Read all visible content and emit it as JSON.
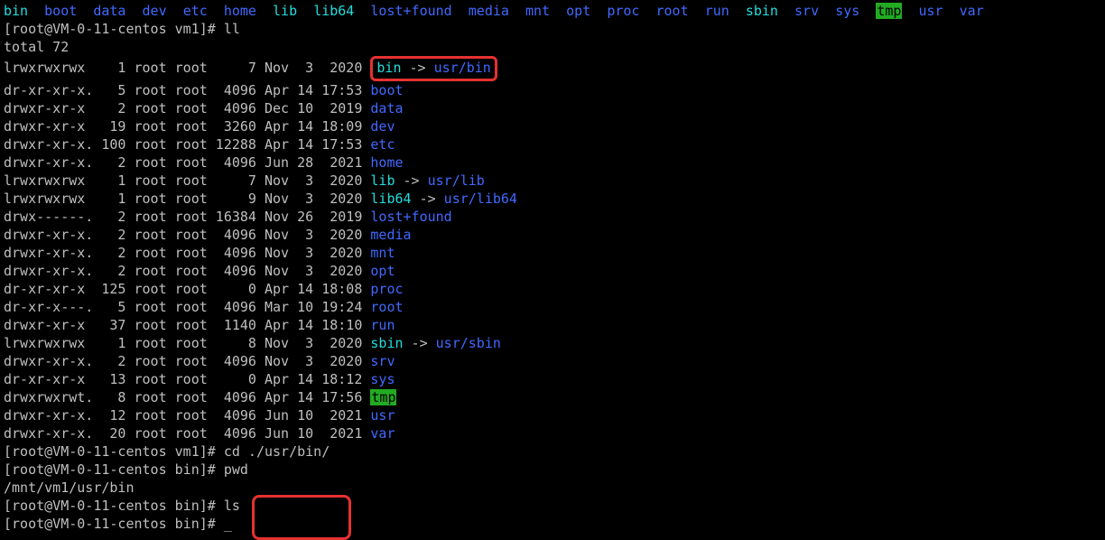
{
  "top_dirs": [
    {
      "name": "bin",
      "color": "cyan"
    },
    {
      "name": "boot",
      "color": "blue"
    },
    {
      "name": "data",
      "color": "blue"
    },
    {
      "name": "dev",
      "color": "blue"
    },
    {
      "name": "etc",
      "color": "blue"
    },
    {
      "name": "home",
      "color": "blue"
    },
    {
      "name": "lib",
      "color": "cyan"
    },
    {
      "name": "lib64",
      "color": "cyan"
    },
    {
      "name": "lost+found",
      "color": "blue"
    },
    {
      "name": "media",
      "color": "blue"
    },
    {
      "name": "mnt",
      "color": "blue"
    },
    {
      "name": "opt",
      "color": "blue"
    },
    {
      "name": "proc",
      "color": "blue"
    },
    {
      "name": "root",
      "color": "blue"
    },
    {
      "name": "run",
      "color": "blue"
    },
    {
      "name": "sbin",
      "color": "cyan"
    },
    {
      "name": "srv",
      "color": "blue"
    },
    {
      "name": "sys",
      "color": "blue"
    },
    {
      "name": "tmp",
      "color": "green-bg"
    },
    {
      "name": "usr",
      "color": "blue"
    },
    {
      "name": "var",
      "color": "blue"
    }
  ],
  "prompt1": "[root@VM-0-11-centos vm1]#",
  "cmd1": "ll",
  "total_line": "total 72",
  "listing": [
    {
      "perm": "lrwxrwxrwx ",
      "nlink": "1",
      "owner": "root",
      "group": "root",
      "size": "7",
      "date": "Nov  3  2020",
      "name": "bin",
      "color": "cyan",
      "link": "usr/bin",
      "highlight": true
    },
    {
      "perm": "dr-xr-xr-x.",
      "nlink": "5",
      "owner": "root",
      "group": "root",
      "size": "4096",
      "date": "Apr 14 17:53",
      "name": "boot",
      "color": "blue"
    },
    {
      "perm": "drwxr-xr-x ",
      "nlink": "2",
      "owner": "root",
      "group": "root",
      "size": "4096",
      "date": "Dec 10  2019",
      "name": "data",
      "color": "blue"
    },
    {
      "perm": "drwxr-xr-x ",
      "nlink": "19",
      "owner": "root",
      "group": "root",
      "size": "3260",
      "date": "Apr 14 18:09",
      "name": "dev",
      "color": "blue"
    },
    {
      "perm": "drwxr-xr-x.",
      "nlink": "100",
      "owner": "root",
      "group": "root",
      "size": "12288",
      "date": "Apr 14 17:53",
      "name": "etc",
      "color": "blue"
    },
    {
      "perm": "drwxr-xr-x.",
      "nlink": "2",
      "owner": "root",
      "group": "root",
      "size": "4096",
      "date": "Jun 28  2021",
      "name": "home",
      "color": "blue"
    },
    {
      "perm": "lrwxrwxrwx ",
      "nlink": "1",
      "owner": "root",
      "group": "root",
      "size": "7",
      "date": "Nov  3  2020",
      "name": "lib",
      "color": "cyan",
      "link": "usr/lib"
    },
    {
      "perm": "lrwxrwxrwx ",
      "nlink": "1",
      "owner": "root",
      "group": "root",
      "size": "9",
      "date": "Nov  3  2020",
      "name": "lib64",
      "color": "cyan",
      "link": "usr/lib64"
    },
    {
      "perm": "drwx------.",
      "nlink": "2",
      "owner": "root",
      "group": "root",
      "size": "16384",
      "date": "Nov 26  2019",
      "name": "lost+found",
      "color": "blue"
    },
    {
      "perm": "drwxr-xr-x.",
      "nlink": "2",
      "owner": "root",
      "group": "root",
      "size": "4096",
      "date": "Nov  3  2020",
      "name": "media",
      "color": "blue"
    },
    {
      "perm": "drwxr-xr-x.",
      "nlink": "2",
      "owner": "root",
      "group": "root",
      "size": "4096",
      "date": "Nov  3  2020",
      "name": "mnt",
      "color": "blue"
    },
    {
      "perm": "drwxr-xr-x.",
      "nlink": "2",
      "owner": "root",
      "group": "root",
      "size": "4096",
      "date": "Nov  3  2020",
      "name": "opt",
      "color": "blue"
    },
    {
      "perm": "dr-xr-xr-x ",
      "nlink": "125",
      "owner": "root",
      "group": "root",
      "size": "0",
      "date": "Apr 14 18:08",
      "name": "proc",
      "color": "blue"
    },
    {
      "perm": "dr-xr-x---.",
      "nlink": "5",
      "owner": "root",
      "group": "root",
      "size": "4096",
      "date": "Mar 10 19:24",
      "name": "root",
      "color": "blue"
    },
    {
      "perm": "drwxr-xr-x ",
      "nlink": "37",
      "owner": "root",
      "group": "root",
      "size": "1140",
      "date": "Apr 14 18:10",
      "name": "run",
      "color": "blue"
    },
    {
      "perm": "lrwxrwxrwx ",
      "nlink": "1",
      "owner": "root",
      "group": "root",
      "size": "8",
      "date": "Nov  3  2020",
      "name": "sbin",
      "color": "cyan",
      "link": "usr/sbin"
    },
    {
      "perm": "drwxr-xr-x.",
      "nlink": "2",
      "owner": "root",
      "group": "root",
      "size": "4096",
      "date": "Nov  3  2020",
      "name": "srv",
      "color": "blue"
    },
    {
      "perm": "dr-xr-xr-x ",
      "nlink": "13",
      "owner": "root",
      "group": "root",
      "size": "0",
      "date": "Apr 14 18:12",
      "name": "sys",
      "color": "blue"
    },
    {
      "perm": "drwxrwxrwt.",
      "nlink": "8",
      "owner": "root",
      "group": "root",
      "size": "4096",
      "date": "Apr 14 17:56",
      "name": "tmp",
      "color": "green-bg"
    },
    {
      "perm": "drwxr-xr-x.",
      "nlink": "12",
      "owner": "root",
      "group": "root",
      "size": "4096",
      "date": "Jun 10  2021",
      "name": "usr",
      "color": "blue"
    },
    {
      "perm": "drwxr-xr-x.",
      "nlink": "20",
      "owner": "root",
      "group": "root",
      "size": "4096",
      "date": "Jun 10  2021",
      "name": "var",
      "color": "blue"
    }
  ],
  "cmd2": "cd ./usr/bin/",
  "prompt2": "[root@VM-0-11-centos bin]#",
  "cmd3": "pwd",
  "pwd_out": "/mnt/vm1/usr/bin",
  "cmd4": "ls"
}
